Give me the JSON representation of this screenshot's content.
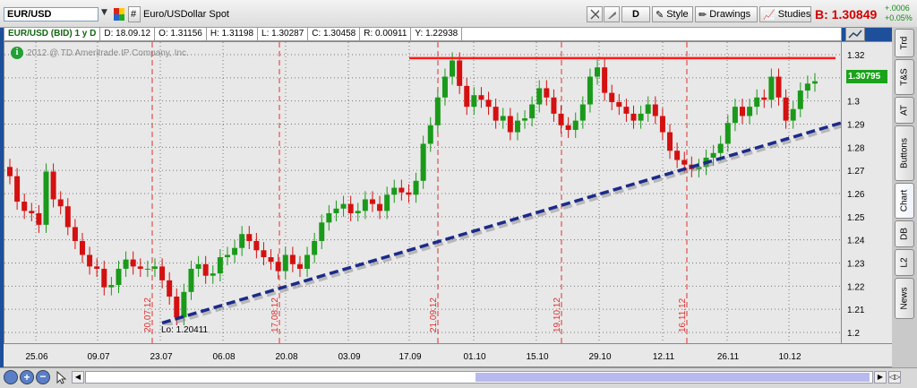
{
  "toolbar": {
    "symbol": "EUR/USD",
    "hash": "#",
    "description": "Euro/USDollar Spot",
    "d_button": "D",
    "style_label": "Style",
    "drawings_label": "Drawings",
    "studies_label": "Studies",
    "bid_text": "B: 1.30849",
    "change_abs": "+.0006",
    "change_pct": "+0.05%"
  },
  "infobar": {
    "title": "EUR/USD (BID) 1 y D",
    "date": "D: 18.09.12",
    "open": "O: 1.31156",
    "high": "H: 1.31198",
    "low": "L: 1.30287",
    "close": "C: 1.30458",
    "range": "R: 0.00911",
    "y": "Y: 1.22938"
  },
  "copyright": "2012 @ TD Ameritrade IP Company, Inc.",
  "info_icon": "i",
  "low_label": "Lo: 1.20411",
  "price_tag": "1.30795",
  "side_tabs": [
    "Trd",
    "T&S",
    "AT",
    "Buttons",
    "Chart",
    "DB",
    "L2",
    "News"
  ],
  "colors": {
    "up": "#1a9a1a",
    "down": "#d41010",
    "resistance": "#ff1a1a",
    "trend": "#1c2a8a",
    "marker": "#e03030"
  },
  "chart_data": {
    "type": "candlestick",
    "ylim": [
      1.195,
      1.325
    ],
    "y_ticks": [
      1.2,
      1.21,
      1.22,
      1.23,
      1.24,
      1.25,
      1.26,
      1.27,
      1.28,
      1.29,
      1.3,
      1.31,
      1.32
    ],
    "x_ticks": [
      "25.06",
      "09.07",
      "23.07",
      "06.08",
      "20.08",
      "03.09",
      "17.09",
      "01.10",
      "15.10",
      "29.10",
      "12.11",
      "26.11",
      "10.12"
    ],
    "grid": true,
    "vertical_markers": [
      "20.07.12",
      "17.08.12",
      "21.09.12",
      "19.10.12",
      "16.11.12"
    ],
    "resistance_level": 1.3185,
    "trendline": {
      "from": {
        "date": "23.07",
        "value": 1.2041
      },
      "to": {
        "date": "after 10.12",
        "value": 1.2905
      }
    },
    "close_series": [
      1.2675,
      1.2565,
      1.2525,
      1.2515,
      1.2465,
      1.2695,
      1.2575,
      1.2545,
      1.2455,
      1.2395,
      1.2335,
      1.2285,
      1.2275,
      1.2195,
      1.2205,
      1.2275,
      1.2315,
      1.2285,
      1.2275,
      1.2275,
      1.2285,
      1.2225,
      1.2155,
      1.2065,
      1.2175,
      1.2275,
      1.2295,
      1.2245,
      1.2255,
      1.2325,
      1.2335,
      1.2365,
      1.2425,
      1.2395,
      1.2355,
      1.2325,
      1.2305,
      1.2265,
      1.2335,
      1.2295,
      1.2275,
      1.2335,
      1.2395,
      1.2475,
      1.2515,
      1.2535,
      1.2555,
      1.2515,
      1.2525,
      1.2575,
      1.2555,
      1.2525,
      1.2595,
      1.2625,
      1.2605,
      1.2595,
      1.2655,
      1.2815,
      1.2895,
      1.3015,
      1.3105,
      1.3175,
      1.3065,
      1.2975,
      1.3025,
      1.3005,
      1.2975,
      1.2915,
      1.2935,
      1.2865,
      1.2915,
      1.2925,
      1.2985,
      1.3055,
      1.3015,
      1.2945,
      1.2895,
      1.2875,
      1.2915,
      1.2985,
      1.3105,
      1.3145,
      1.3035,
      1.2995,
      1.2975,
      1.2945,
      1.2915,
      1.2945,
      1.2985,
      1.2935,
      1.2865,
      1.2785,
      1.2745,
      1.2725,
      1.2705,
      1.2715,
      1.2755,
      1.2775,
      1.2815,
      1.2905,
      1.2975,
      1.2935,
      1.2975,
      1.3015,
      1.3005,
      1.3105,
      1.3015,
      1.2915,
      1.2965,
      1.3045,
      1.3075,
      1.3085
    ]
  }
}
